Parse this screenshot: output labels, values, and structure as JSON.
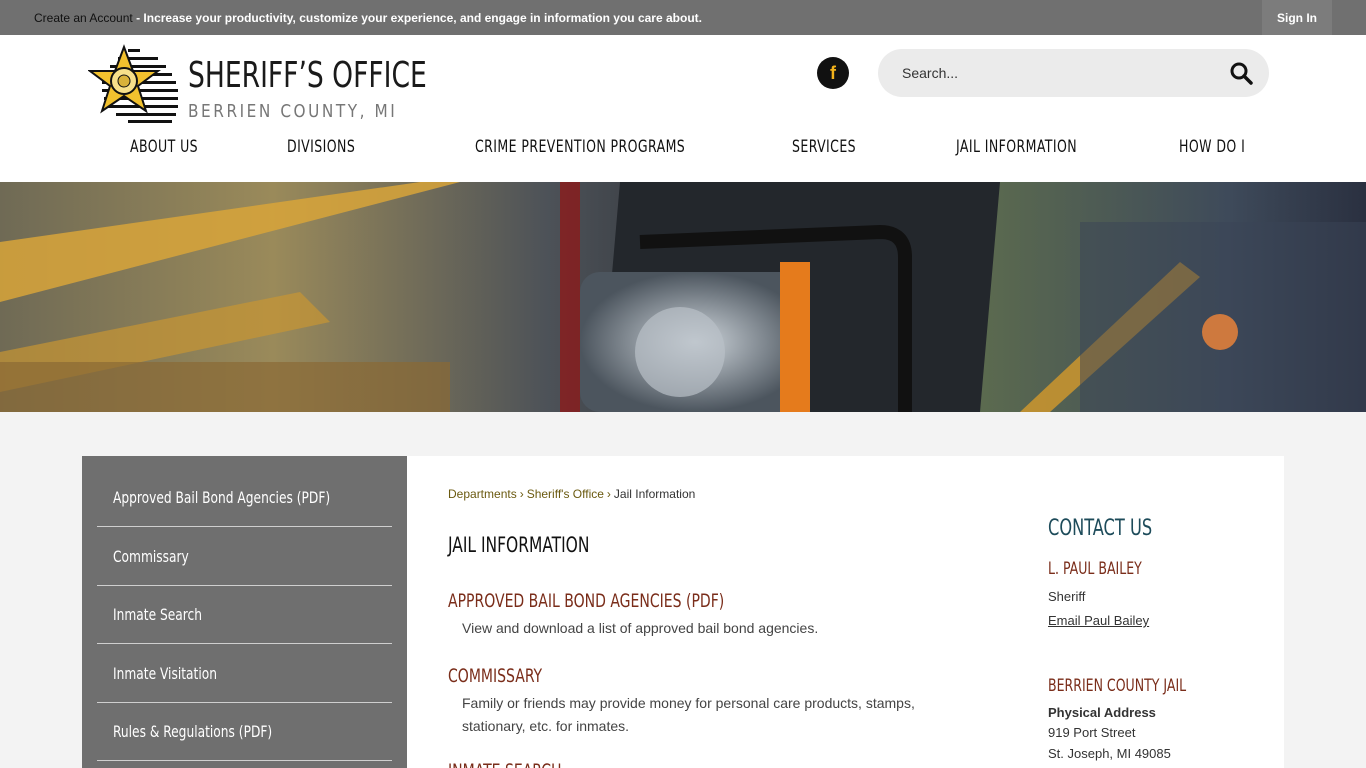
{
  "topbar": {
    "create_account": "Create an Account",
    "message": " - Increase your productivity, customize your experience, and engage in information you care about.",
    "sign_in": "Sign In"
  },
  "header": {
    "logo_title": "SHERIFF’S OFFICE",
    "logo_subtitle": "BERRIEN COUNTY, MI",
    "facebook_icon": "facebook-icon",
    "search": {
      "placeholder": "Search...",
      "icon": "search-icon"
    }
  },
  "nav": {
    "items": [
      {
        "label": "ABOUT US"
      },
      {
        "label": "DIVISIONS"
      },
      {
        "label": "CRIME PREVENTION PROGRAMS"
      },
      {
        "label": "SERVICES"
      },
      {
        "label": "JAIL INFORMATION"
      },
      {
        "label": "HOW DO I"
      }
    ]
  },
  "sidebar": {
    "items": [
      {
        "label": "Approved Bail Bond Agencies (PDF)"
      },
      {
        "label": "Commissary"
      },
      {
        "label": "Inmate Search"
      },
      {
        "label": "Inmate Visitation"
      },
      {
        "label": "Rules & Regulations (PDF)"
      }
    ]
  },
  "breadcrumb": {
    "items": [
      "Departments",
      "Sheriff's Office"
    ],
    "current": "Jail Information",
    "separator": "›"
  },
  "main": {
    "title": "JAIL INFORMATION",
    "entries": [
      {
        "title": "APPROVED BAIL BOND AGENCIES (PDF)",
        "desc": "View and download a list of approved bail bond agencies."
      },
      {
        "title": "COMMISSARY",
        "desc": "Family or friends may provide money for personal care products, stamps, stationary, etc. for inmates."
      }
    ],
    "peek": "INMATE SEARCH"
  },
  "contact": {
    "heading": "CONTACT US",
    "person": {
      "name": "L. PAUL BAILEY",
      "role": "Sheriff",
      "email_label": "Email Paul Bailey"
    },
    "jail": {
      "name": "BERRIEN COUNTY JAIL",
      "address_label": "Physical Address",
      "street": "919 Port Street",
      "city": "St. Joseph, MI 49085"
    }
  },
  "colors": {
    "topbar": "#707070",
    "sidebar": "#6f6f6f",
    "accent_brown": "#7a2d1a",
    "accent_teal": "#1d4b5a",
    "facebook_icon_fg": "#f2b21b"
  }
}
